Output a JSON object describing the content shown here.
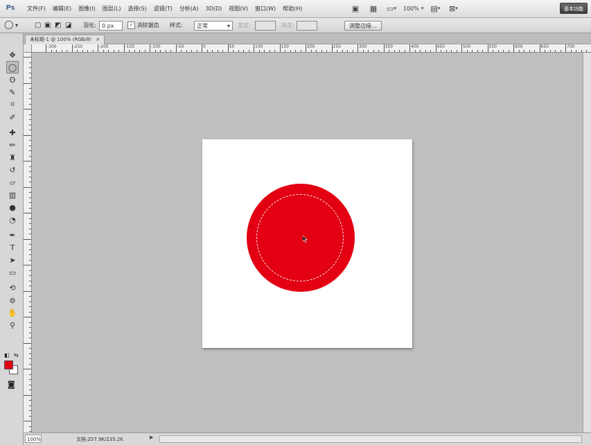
{
  "app": {
    "logo": "Ps"
  },
  "menu": {
    "items": [
      "文件(F)",
      "编辑(E)",
      "图像(I)",
      "图层(L)",
      "选择(S)",
      "滤镜(T)",
      "分析(A)",
      "3D(D)",
      "视图(V)",
      "窗口(W)",
      "帮助(H)"
    ],
    "zoom": "100%",
    "workspace_button": "基本功能"
  },
  "options_bar": {
    "feather_label": "羽化:",
    "feather_value": "0 px",
    "antialias_check": "✓",
    "antialias_label": "消除锯齿",
    "style_label": "样式:",
    "style_value": "正常",
    "width_label": "宽度:",
    "height_label": "高度:",
    "refine_button": "调整边缘..."
  },
  "document": {
    "tab_title": "未标题-1 @ 100% (RGB/8)",
    "fill_color": "#e30012",
    "background_color": "#ffffff"
  },
  "ruler": {
    "h_labels": [
      "-300",
      "-250",
      "-200",
      "-150",
      "-100",
      "-50",
      "0",
      "50",
      "100",
      "150",
      "200",
      "250",
      "300",
      "350",
      "400",
      "450",
      "500",
      "550",
      "600",
      "650",
      "700",
      "750"
    ]
  },
  "colors": {
    "foreground": "#e30012",
    "background": "#ffffff",
    "canvas_bg": "#bfbfbf"
  },
  "status": {
    "zoom": "100%",
    "doc_info": "文档:257.9K/235.2K"
  }
}
